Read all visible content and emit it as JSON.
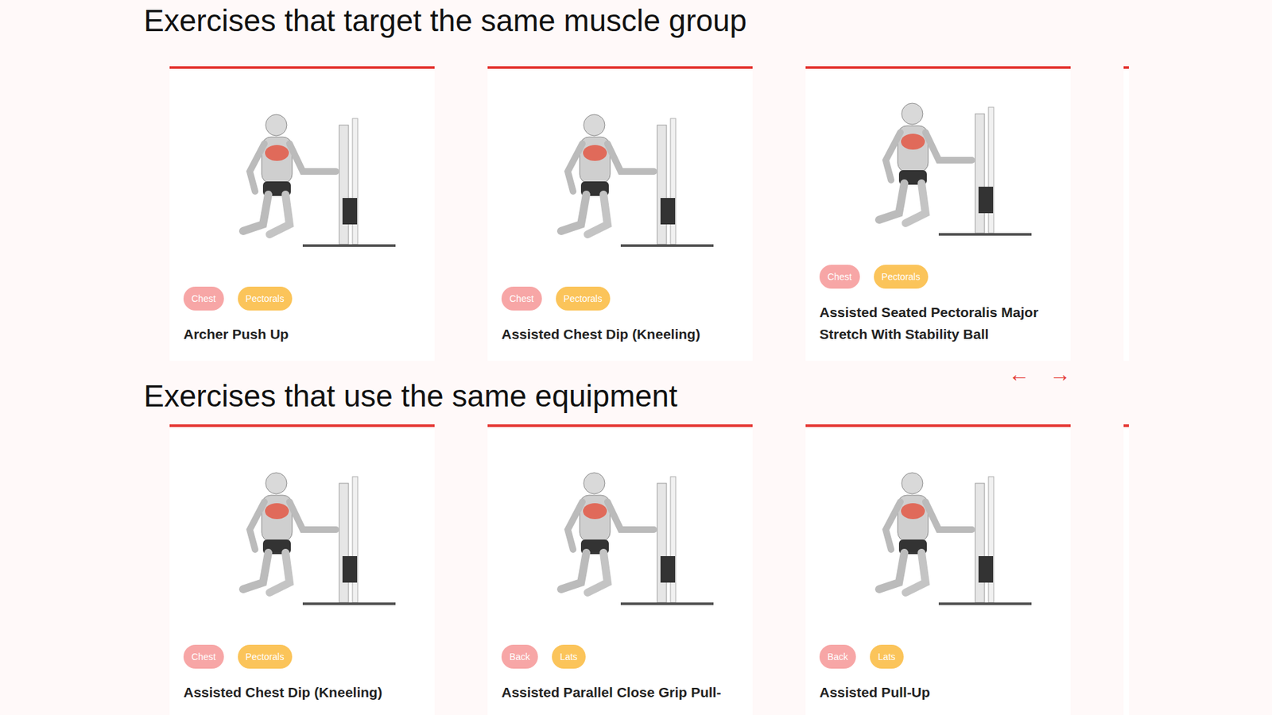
{
  "sections": [
    {
      "title": "Exercises that target the same muscle group",
      "cards": [
        {
          "title": "Archer Push Up",
          "tags": [
            {
              "label": "Chest",
              "color": "#f7a6a6"
            },
            {
              "label": "Pectorals",
              "color": "#fbc45a"
            }
          ]
        },
        {
          "title": "Assisted Chest Dip (Kneeling)",
          "tags": [
            {
              "label": "Chest",
              "color": "#f7a6a6"
            },
            {
              "label": "Pectorals",
              "color": "#fbc45a"
            }
          ]
        },
        {
          "title": "Assisted Seated Pectoralis Major Stretch With Stability Ball",
          "tags": [
            {
              "label": "Chest",
              "color": "#f7a6a6"
            },
            {
              "label": "Pectorals",
              "color": "#fbc45a"
            }
          ]
        }
      ],
      "nav": {
        "prev": "←",
        "next": "→"
      }
    },
    {
      "title": "Exercises that use the same equipment",
      "cards": [
        {
          "title": "Assisted Chest Dip (Kneeling)",
          "tags": [
            {
              "label": "Chest",
              "color": "#f7a6a6"
            },
            {
              "label": "Pectorals",
              "color": "#fbc45a"
            }
          ]
        },
        {
          "title": "Assisted Parallel Close Grip Pull-",
          "tags": [
            {
              "label": "Back",
              "color": "#f7a6a6"
            },
            {
              "label": "Lats",
              "color": "#fbc45a"
            }
          ]
        },
        {
          "title": "Assisted Pull-Up",
          "tags": [
            {
              "label": "Back",
              "color": "#f7a6a6"
            },
            {
              "label": "Lats",
              "color": "#fbc45a"
            }
          ]
        }
      ]
    }
  ]
}
